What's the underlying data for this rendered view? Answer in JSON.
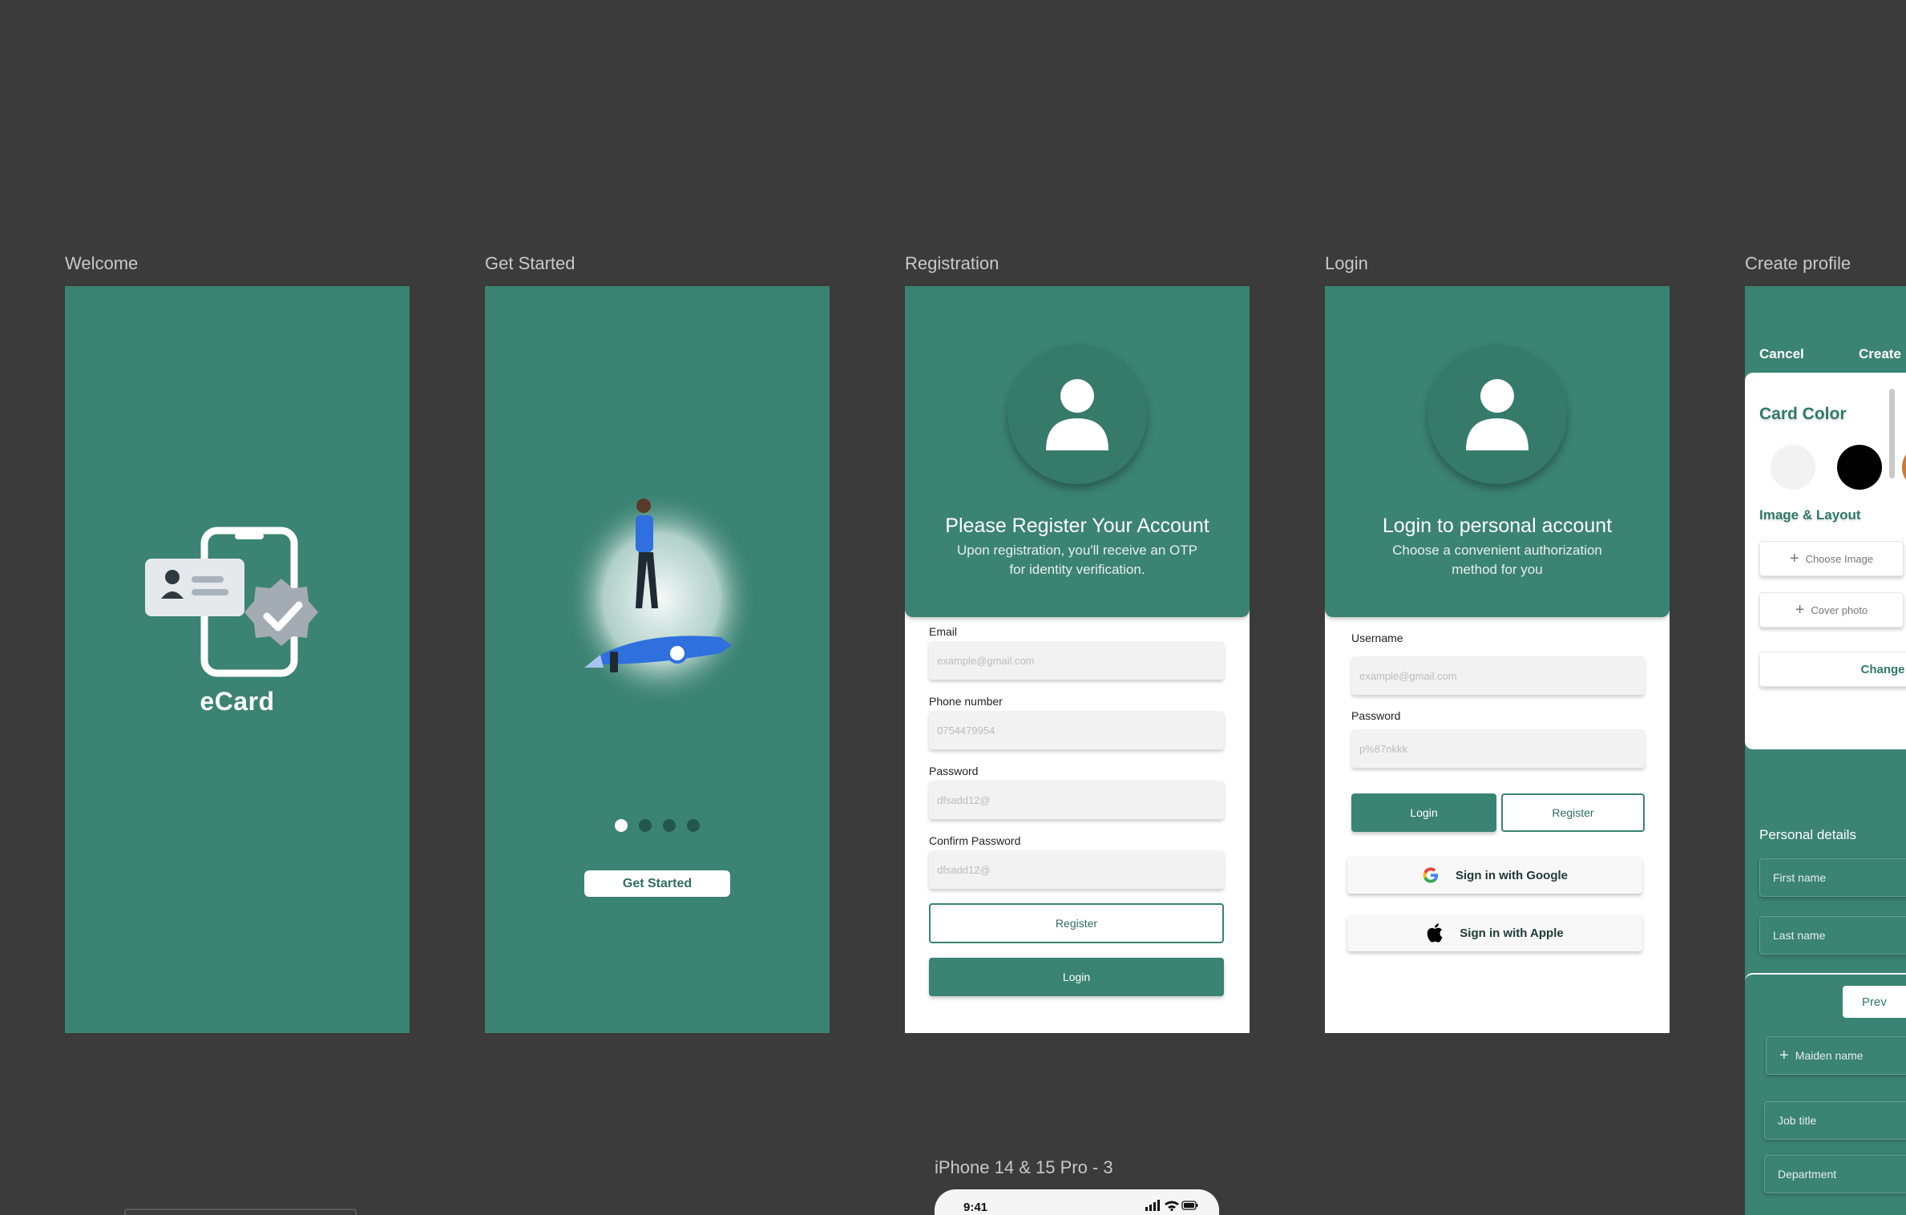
{
  "frames": {
    "welcome": {
      "label": "Welcome",
      "brand": "eCard"
    },
    "get_started": {
      "label": "Get Started",
      "button": "Get Started",
      "dots": 4,
      "active_dot": 1
    },
    "registration": {
      "label": "Registration",
      "title": "Please Register Your Account",
      "subtitle": "Upon registration, you'll receive an OTP for identity verification.",
      "fields": [
        {
          "label": "Email",
          "placeholder": "example@gmail.com"
        },
        {
          "label": "Phone number",
          "placeholder": "0754479954"
        },
        {
          "label": "Password",
          "placeholder": "dfsadd12@"
        },
        {
          "label": "Confirm Password",
          "placeholder": "dfsadd12@"
        }
      ],
      "register_button": "Register",
      "login_button": "Login"
    },
    "login": {
      "label": "Login",
      "title": "Login to personal account",
      "subtitle": "Choose a convenient authorization method for you",
      "fields": [
        {
          "label": "Username",
          "placeholder": "example@gmail.com"
        },
        {
          "label": "Password",
          "placeholder": "p%87nkkk"
        }
      ],
      "login_button": "Login",
      "register_button": "Register",
      "google_button": "Sign in with Google",
      "apple_button": "Sign in with Apple"
    },
    "create_profile": {
      "label": "Create profile",
      "cancel": "Cancel",
      "create": "Create",
      "card_color": "Card Color",
      "image_layout": "Image & Layout",
      "choose_image": "Choose Image",
      "cover_photo": "Cover photo",
      "change_image": "Change In",
      "personal_details": "Personal details",
      "first_name": "First name",
      "last_name": "Last name",
      "preview": "Prev",
      "maiden_name": "Maiden name",
      "job_title": "Job title",
      "department": "Department",
      "swatch_colors": [
        "#f2f2f2",
        "#000000",
        "#c77b3d"
      ]
    }
  },
  "phone": {
    "label": "iPhone 14 & 15 Pro - 3",
    "time": "9:41"
  },
  "colors": {
    "canvas": "#3b3b3b",
    "teal": "#3b8372",
    "teal_dark": "#24574b"
  }
}
